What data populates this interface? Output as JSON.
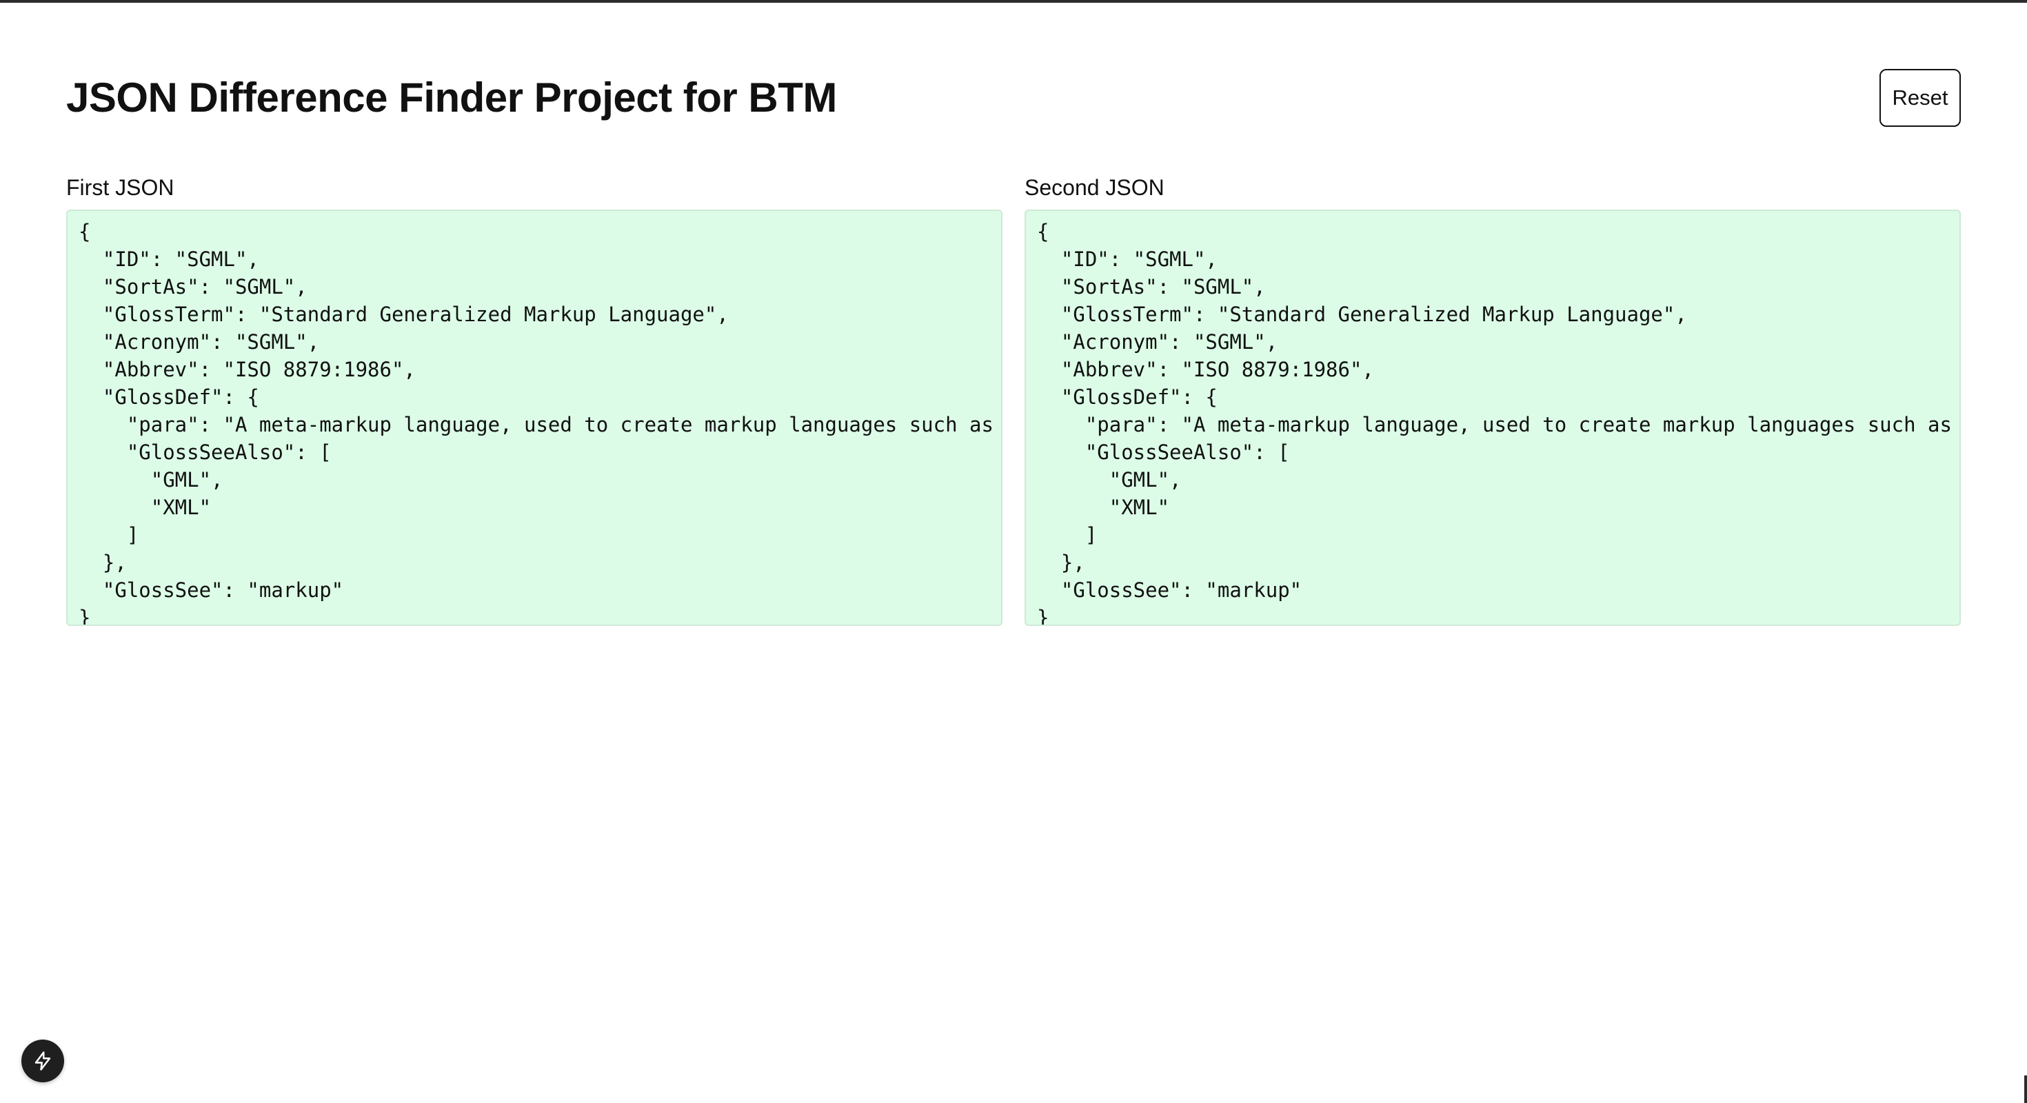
{
  "header": {
    "title": "JSON Difference Finder Project for BTM",
    "reset_label": "Reset"
  },
  "panels": {
    "first": {
      "label": "First JSON",
      "content": "{\n  \"ID\": \"SGML\",\n  \"SortAs\": \"SGML\",\n  \"GlossTerm\": \"Standard Generalized Markup Language\",\n  \"Acronym\": \"SGML\",\n  \"Abbrev\": \"ISO 8879:1986\",\n  \"GlossDef\": {\n    \"para\": \"A meta-markup language, used to create markup languages such as Doc\n    \"GlossSeeAlso\": [\n      \"GML\",\n      \"XML\"\n    ]\n  },\n  \"GlossSee\": \"markup\"\n}"
    },
    "second": {
      "label": "Second JSON",
      "content": "{\n  \"ID\": \"SGML\",\n  \"SortAs\": \"SGML\",\n  \"GlossTerm\": \"Standard Generalized Markup Language\",\n  \"Acronym\": \"SGML\",\n  \"Abbrev\": \"ISO 8879:1986\",\n  \"GlossDef\": {\n    \"para\": \"A meta-markup language, used to create markup languages such as Doc\n    \"GlossSeeAlso\": [\n      \"GML\",\n      \"XML\"\n    ]\n  },\n  \"GlossSee\": \"markup\"\n}"
    }
  },
  "colors": {
    "match_background": "#dcfce7",
    "match_border": "#cfe9d7",
    "text": "#111111",
    "fab_background": "#1f1f1f"
  },
  "icons": {
    "fab": "lightning-bolt-icon"
  }
}
